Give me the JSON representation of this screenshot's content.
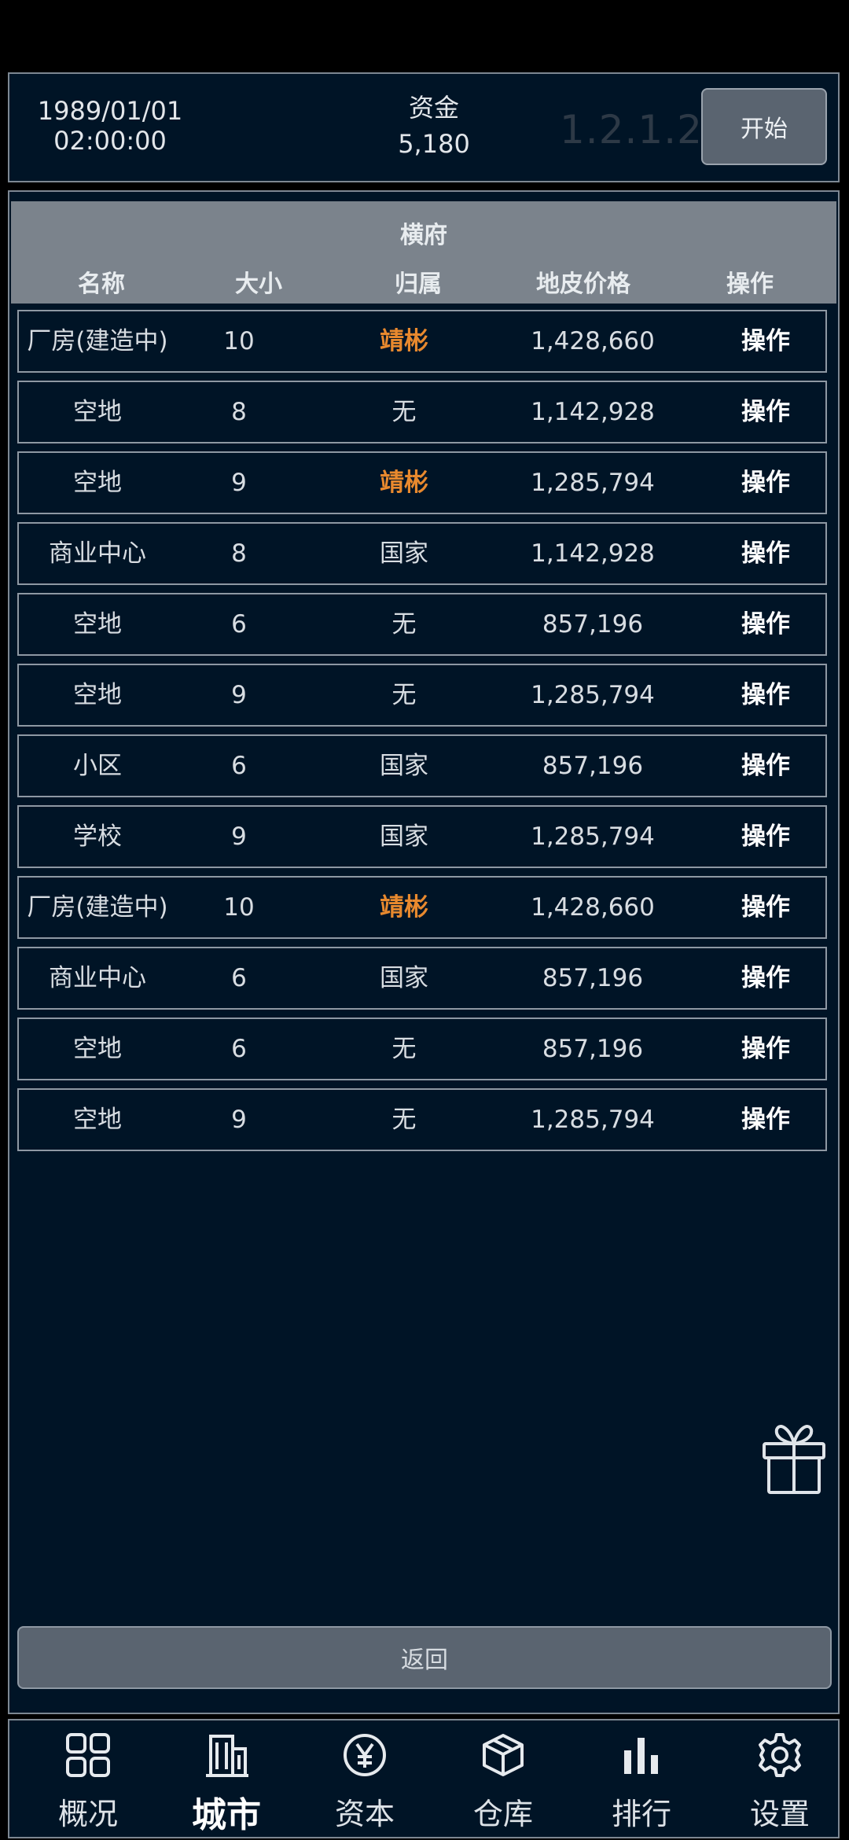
{
  "header": {
    "date": "1989/01/01",
    "time": "02:00:00",
    "funds_label": "资金",
    "funds_value": "5,180",
    "version": "1.2.1.2",
    "start_button": "开始"
  },
  "table": {
    "title": "横府",
    "columns": [
      "名称",
      "大小",
      "归属",
      "地皮价格",
      "操作"
    ],
    "rows": [
      {
        "name": "厂房(建造中)",
        "size": "10",
        "owner": "靖彬",
        "price": "1,428,660",
        "action": "操作"
      },
      {
        "name": "空地",
        "size": "8",
        "owner": "无",
        "price": "1,142,928",
        "action": "操作"
      },
      {
        "name": "空地",
        "size": "9",
        "owner": "靖彬",
        "price": "1,285,794",
        "action": "操作"
      },
      {
        "name": "商业中心",
        "size": "8",
        "owner": "国家",
        "price": "1,142,928",
        "action": "操作"
      },
      {
        "name": "空地",
        "size": "6",
        "owner": "无",
        "price": "857,196",
        "action": "操作"
      },
      {
        "name": "空地",
        "size": "9",
        "owner": "无",
        "price": "1,285,794",
        "action": "操作"
      },
      {
        "name": "小区",
        "size": "6",
        "owner": "国家",
        "price": "857,196",
        "action": "操作"
      },
      {
        "name": "学校",
        "size": "9",
        "owner": "国家",
        "price": "1,285,794",
        "action": "操作"
      },
      {
        "name": "厂房(建造中)",
        "size": "10",
        "owner": "靖彬",
        "price": "1,428,660",
        "action": "操作"
      },
      {
        "name": "商业中心",
        "size": "6",
        "owner": "国家",
        "price": "857,196",
        "action": "操作"
      },
      {
        "name": "空地",
        "size": "6",
        "owner": "无",
        "price": "857,196",
        "action": "操作"
      },
      {
        "name": "空地",
        "size": "9",
        "owner": "无",
        "price": "1,285,794",
        "action": "操作"
      }
    ]
  },
  "back_button": "返回",
  "gift_icon": "gift-icon",
  "nav": [
    {
      "label": "概况",
      "icon": "grid-icon",
      "active": false
    },
    {
      "label": "城市",
      "icon": "building-icon",
      "active": true
    },
    {
      "label": "资本",
      "icon": "yen-icon",
      "active": false
    },
    {
      "label": "仓库",
      "icon": "box-icon",
      "active": false
    },
    {
      "label": "排行",
      "icon": "bar-chart-icon",
      "active": false
    },
    {
      "label": "设置",
      "icon": "gear-icon",
      "active": false
    }
  ],
  "colors": {
    "background": "#001426",
    "owner_player": "#e8892e",
    "header_band": "#7b838c",
    "button": "#5a6470"
  }
}
